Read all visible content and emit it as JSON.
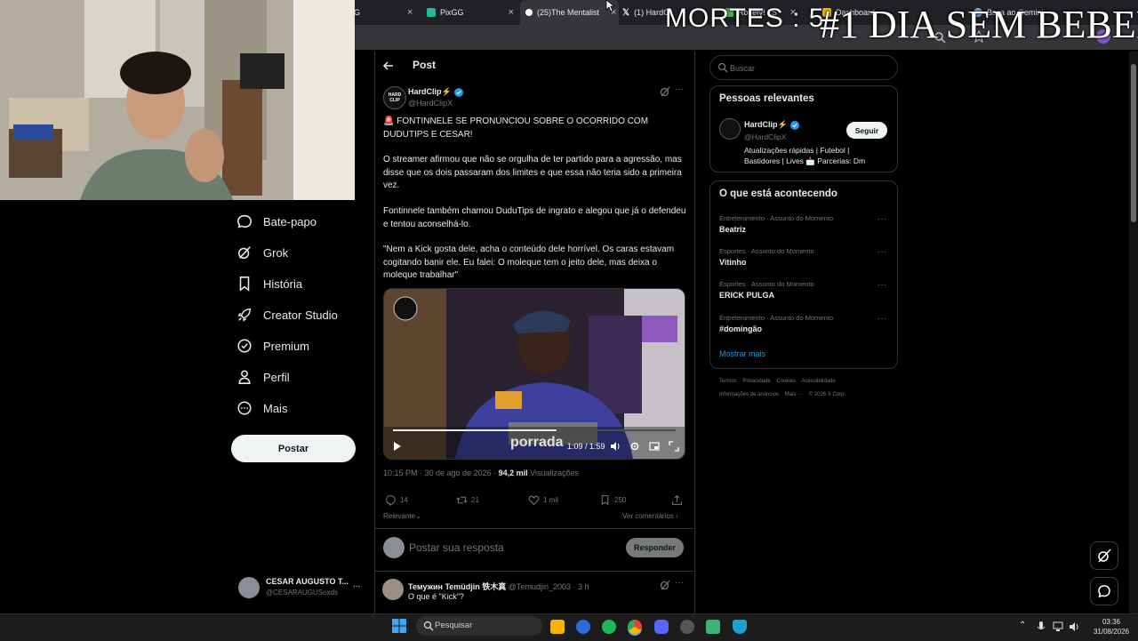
{
  "browser": {
    "tabs": [
      {
        "label": "G",
        "color": "#1d9bf0"
      },
      {
        "label": "PixGG",
        "color": "#1abc9c"
      },
      {
        "label": "(25)The Mentalist",
        "color": "#ffffff"
      },
      {
        "label": "(1) HardCli",
        "color": "#ffffff"
      },
      {
        "label": "Rocefy! | S",
        "color": "#4caf50"
      },
      {
        "label": "Dashboard",
        "color": "#f4b400"
      },
      {
        "label": "Bsca ao Gemini",
        "color": "#8ab4f8"
      }
    ]
  },
  "overlay": {
    "mortes": "MORTES : 5",
    "dia": "#1 DIA SEM BEBER"
  },
  "nav": {
    "items": [
      {
        "label": "Bate-papo",
        "icon": "chat-icon"
      },
      {
        "label": "Grok",
        "icon": "grok-icon"
      },
      {
        "label": "História",
        "icon": "bookmark-icon"
      },
      {
        "label": "Creator Studio",
        "icon": "rocket-icon"
      },
      {
        "label": "Premium",
        "icon": "verified-icon"
      },
      {
        "label": "Perfil",
        "icon": "person-icon"
      },
      {
        "label": "Mais",
        "icon": "more-circle-icon"
      }
    ],
    "post_button": "Postar"
  },
  "profile": {
    "name": "CESAR AUGUSTO T...",
    "handle": "@CESARAUGUSoxds",
    "more": "..."
  },
  "post": {
    "header_title": "Post",
    "author_name": "HardClip⚡",
    "author_handle": "@HardClipX",
    "avatar_text": "HARD CLIP",
    "paragraphs": [
      "🚨 FONTINNELE SE PRONUNCIOU SOBRE O OCORRIDO COM DUDUTIPS E CESAR!",
      "O streamer afirmou que não se orgulha de ter partido para a agressão, mas disse que os dois passaram dos limites e que essa não teria sido a primeira vez.",
      "Fontinnele também chamou DuduTips de ingrato e alegou que já o defendeu e tentou aconselhá-lo.",
      "\"Nem a Kick gosta dele, acha o conteúdo dele horrível. Os caras estavam cogitando banir ele. Eu falei: O moleque tem o jeito dele, mas deixa o moleque trabalhar\""
    ],
    "video": {
      "time": "1:09 / 1:59",
      "progress": 0.58,
      "caption": "porrada"
    },
    "timestamp": "10:15 PM · 30 de ago de 2026 ·",
    "views_value": "94,2 mil",
    "views_label": "Visualizações",
    "stats": {
      "replies": "14",
      "reposts": "21",
      "likes": "1 mil",
      "bookmarks": "250"
    },
    "sort_label": "Relevante",
    "view_quotes": "Ver comentários",
    "reply_placeholder": "Postar sua resposta",
    "reply_button": "Responder"
  },
  "reply": {
    "name": "Темужин Temüdjin 铁木真",
    "handle_time": "@Temudjin_2003 · 3 h",
    "text": "O que é \"Kick\"?"
  },
  "search": {
    "placeholder": "Buscar"
  },
  "relevant": {
    "title": "Pessoas relevantes",
    "name": "HardClip⚡",
    "handle": "@HardClipX",
    "bio": "Atualizações rápidas | Futebol | Bastidores | Lives 📩 Parcerias: Dm",
    "follow_button": "Seguir"
  },
  "trending": {
    "title": "O que está acontecendo",
    "items": [
      {
        "category": "Entretenimento · Assunto do Momento",
        "name": "Beatriz"
      },
      {
        "category": "Esportes · Assunto do Momento",
        "name": "Vitinho"
      },
      {
        "category": "Esportes · Assunto do Momento",
        "name": "ERICK PULGA"
      },
      {
        "category": "Entretenimento · Assunto do Momento",
        "name": "#domingão"
      }
    ],
    "show_more": "Mostrar mais"
  },
  "footer": {
    "line1": "Termos    Privacidade    Cookies    Acessibilidade",
    "line2": "Informações de anúncios    Mais ···    © 2026 X Corp."
  },
  "taskbar": {
    "search_placeholder": "Pesquisar",
    "time": "03:36",
    "date": "31/08/2026"
  },
  "colors": {
    "accent": "#1d9bf0",
    "background": "#000000",
    "border": "#2f3336",
    "muted": "#71767b"
  }
}
